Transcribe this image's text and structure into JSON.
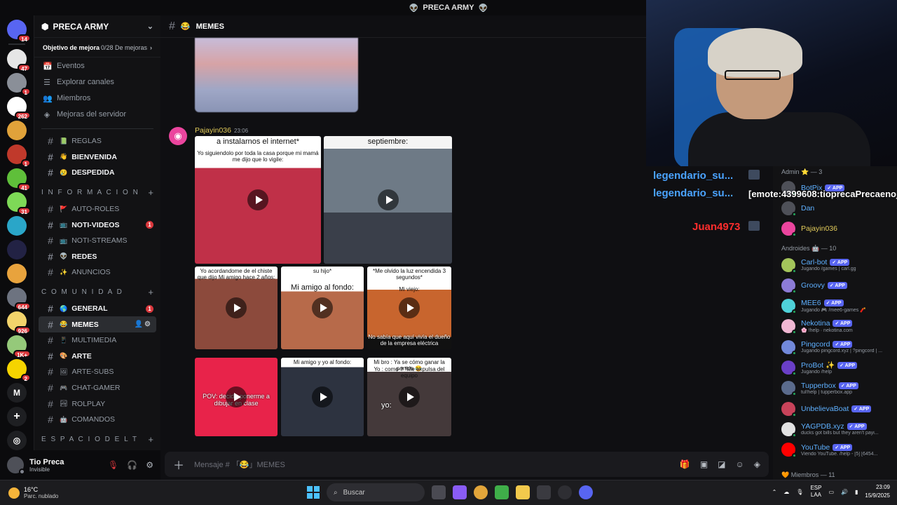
{
  "window": {
    "title": "PRECA ARMY",
    "title_emoji": "👽"
  },
  "rail": {
    "servers": [
      {
        "name": "home",
        "badge": "14",
        "color": "#5865f2"
      },
      {
        "name": "s1",
        "badge": "47",
        "color": "#e6e6e6"
      },
      {
        "name": "s2",
        "badge": "1",
        "color": "#8a8f98"
      },
      {
        "name": "s3",
        "badge": "262",
        "color": "#ffffff"
      },
      {
        "name": "s4",
        "badge": "",
        "color": "#e0a23a"
      },
      {
        "name": "s5",
        "badge": "1",
        "color": "#c0392b"
      },
      {
        "name": "s6",
        "badge": "41",
        "color": "#5fbf3a"
      },
      {
        "name": "s7",
        "badge": "31",
        "color": "#7ed957"
      },
      {
        "name": "s8",
        "badge": "",
        "color": "#2aa6c8"
      },
      {
        "name": "s9",
        "badge": "",
        "color": "#222244"
      },
      {
        "name": "s10",
        "badge": "",
        "color": "#e8a33d"
      },
      {
        "name": "s11",
        "badge": "644",
        "color": "#6d7380"
      },
      {
        "name": "s12",
        "badge": "926",
        "color": "#f2d36b"
      },
      {
        "name": "s13",
        "badge": "1K+",
        "color": "#95c97a"
      },
      {
        "name": "s14",
        "badge": "2",
        "color": "#f5d400"
      },
      {
        "name": "s15",
        "badge": "",
        "color": "#1e1f22",
        "letter": "M"
      }
    ]
  },
  "sidebar": {
    "server_name": "PRECA ARMY",
    "goal_label": "Objetivo de mejora",
    "goal_progress": "0/28 De mejoras",
    "nav": [
      {
        "label": "Eventos",
        "icon": "📅"
      },
      {
        "label": "Explorar canales",
        "icon": "☰"
      },
      {
        "label": "Miembros",
        "icon": "👥"
      },
      {
        "label": "Mejoras del servidor",
        "icon": "◈"
      }
    ],
    "channels_top": [
      {
        "label": "REGLAS",
        "emoji": "📗",
        "unread": false
      },
      {
        "label": "BIENVENIDA",
        "emoji": "👋",
        "unread": true
      },
      {
        "label": "DESPEDIDA",
        "emoji": "😢",
        "unread": true
      }
    ],
    "category_info": "I N F O R M A C I O N",
    "channels_info": [
      {
        "label": "AUTO-ROLES",
        "emoji": "🚩",
        "unread": false,
        "badge": ""
      },
      {
        "label": "NOTI-VIDEOS",
        "emoji": "📺",
        "unread": true,
        "badge": "1"
      },
      {
        "label": "NOTI-STREAMS",
        "emoji": "📺",
        "unread": false,
        "badge": ""
      },
      {
        "label": "REDES",
        "emoji": "👽",
        "unread": true,
        "badge": ""
      },
      {
        "label": "ANUNCIOS",
        "emoji": "✨",
        "unread": false,
        "badge": ""
      }
    ],
    "category_com": "C O M U N I D A D",
    "channels_com": [
      {
        "label": "GENERAL",
        "emoji": "🌎",
        "unread": true,
        "badge": "1"
      },
      {
        "label": "MEMES",
        "emoji": "😂",
        "unread": false,
        "active": true
      },
      {
        "label": "MULTIMEDIA",
        "emoji": "📱",
        "unread": false
      },
      {
        "label": "ARTE",
        "emoji": "🎨",
        "unread": true
      },
      {
        "label": "ARTE-SUBS",
        "emoji": "🖼",
        "unread": false
      },
      {
        "label": "CHAT-GAMER",
        "emoji": "🎮",
        "unread": false
      },
      {
        "label": "ROLPLAY",
        "emoji": "🏞",
        "unread": false
      },
      {
        "label": "COMANDOS",
        "emoji": "🤖",
        "unread": false
      }
    ],
    "category_esp": "E S P A C I O D E L T"
  },
  "user": {
    "name": "Tio Preca",
    "status": "Invisible"
  },
  "channel": {
    "name": "MEMES",
    "emoji": "😂"
  },
  "message": {
    "author": "Pajayin036",
    "time": "23:06",
    "media": [
      {
        "top": "a instalarnos el internet*",
        "sub": "Yo siguiendolo por toda la casa porque mi mamá me dijo que lo vigile:"
      },
      {
        "top": "septiembre:",
        "sub": ""
      },
      {
        "top": "Yo acordandome de el chiste que dijo Mi amigo hace 2 años:",
        "sub": ""
      },
      {
        "top": "su hijo*",
        "sub": "Mi amigo al fondo:"
      },
      {
        "top": "*Me olvido la luz encendida 3 segundos*",
        "sub": "Mi viejo:",
        "bottom": "No sabía que aquí vivía el dueño de la empresa eléctrica"
      },
      {
        "top": "POV: decido ponerme a dibujar en clase",
        "sub": ""
      },
      {
        "top": "Mi amigo y yo al fondo:",
        "sub": ""
      },
      {
        "top": "Mi bro : Ya se cómo ganar la partida 😂",
        "sub": "Yo : como ? *Me expulsa del equipo",
        "bottom": "yo:"
      }
    ]
  },
  "composer": {
    "placeholder": "Mensaje # 「😂」MEMES"
  },
  "overlay": {
    "chat": [
      {
        "user": "legendario_su...",
        "text": ""
      },
      {
        "user": "legendario_su...",
        "text": "[emote:4399608:tioprecaPrecaenojado"
      },
      {
        "user": "Juan4973",
        "text": ""
      }
    ]
  },
  "members": {
    "admin_group": "Admin ⭐ — 3",
    "admins": [
      {
        "name": "BotPix",
        "app": true,
        "color": "#5eb0ff"
      },
      {
        "name": "Dan",
        "app": false,
        "color": "#5eb0ff"
      },
      {
        "name": "Pajayin036",
        "app": false,
        "color": "#e3cc5a"
      }
    ],
    "android_group": "Androides 🤖 — 10",
    "bots": [
      {
        "name": "Carl-bot",
        "activity": "Jugando /games | carl.gg",
        "avatar": "#a3c45b"
      },
      {
        "name": "Groovy",
        "activity": "",
        "avatar": "#8c7bd6"
      },
      {
        "name": "MEE6",
        "activity": "Jugando 🎮 /mee6-games 🧨",
        "avatar": "#4fd1d9"
      },
      {
        "name": "Nekotina",
        "activity": "🌸 !help · nekotina.com",
        "avatar": "#f0b7d3"
      },
      {
        "name": "Pingcord",
        "activity": "Jugando pingcord.xyz | ?pingcord | ...",
        "avatar": "#7289da"
      },
      {
        "name": "ProBot ✨",
        "activity": "Jugando /help",
        "avatar": "#6a3fc7"
      },
      {
        "name": "Tupperbox",
        "activity": "tul!help | tupperbox.app",
        "avatar": "#5b6b8c"
      },
      {
        "name": "UnbelievaBoat",
        "activity": "",
        "avatar": "#c8435a"
      },
      {
        "name": "YAGPDB.xyz",
        "activity": "ducks got bills but they aren't payi...",
        "avatar": "#e2e2e2"
      },
      {
        "name": "YouTube",
        "activity": "Viendo YouTube. /help - [5] [6454...",
        "avatar": "#ff0000"
      }
    ],
    "app_badge": "✓ APP",
    "footer": "🧡 Miembros — 11"
  },
  "taskbar": {
    "temp": "16°C",
    "weather": "Parc. nublado",
    "search": "Buscar",
    "lang1": "ESP",
    "lang2": "LAA",
    "time": "23:09",
    "date": "15/9/2025"
  }
}
